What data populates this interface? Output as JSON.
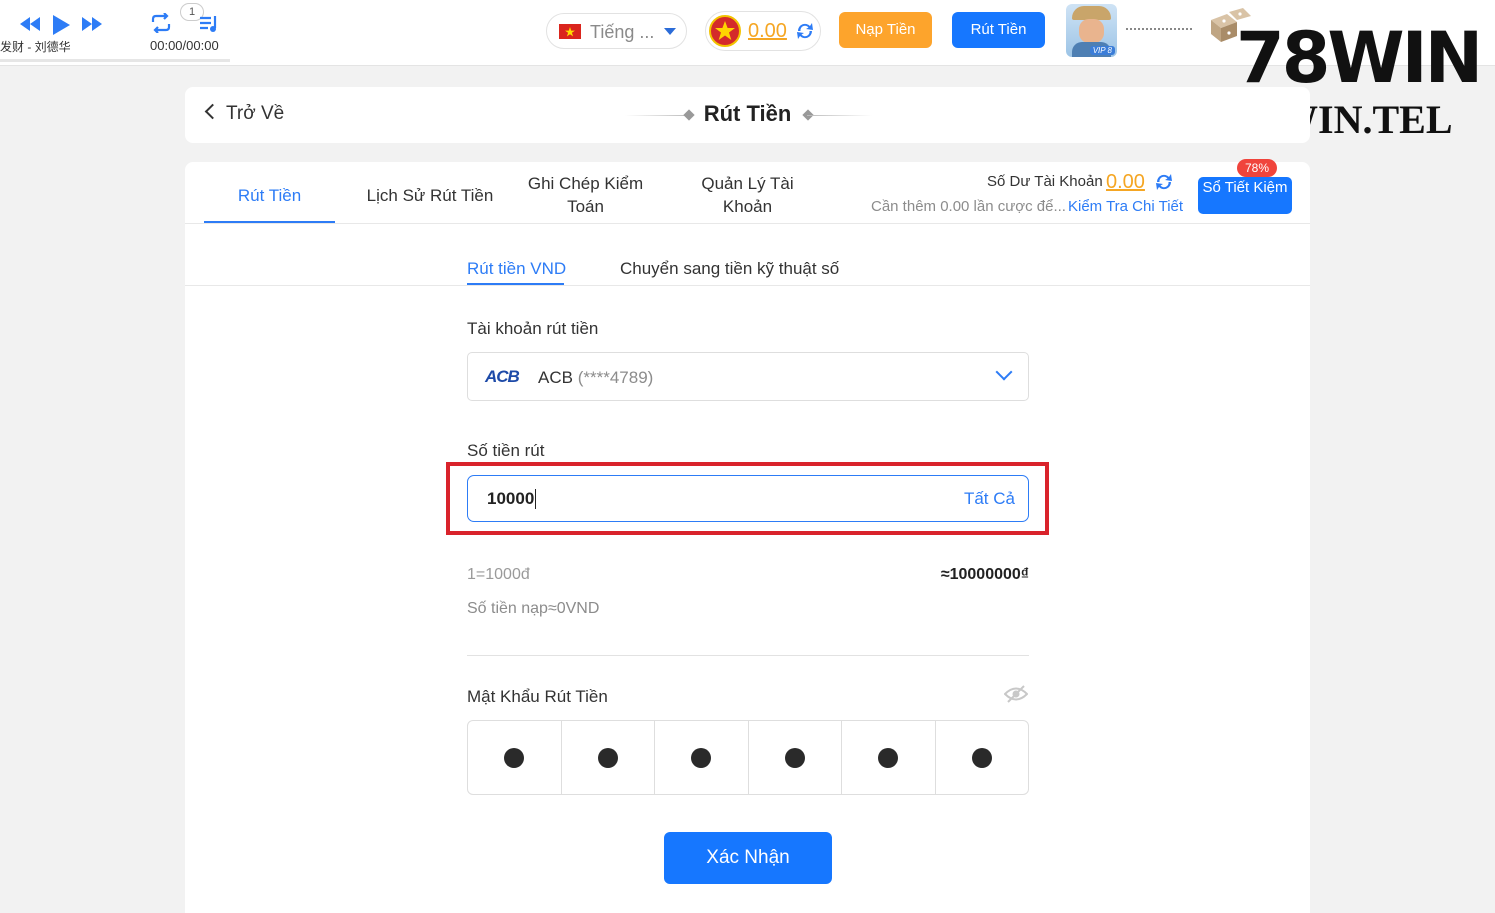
{
  "player": {
    "song": "发财 - 刘德华",
    "time": "00:00/00:00",
    "queue_count": "1"
  },
  "topbar": {
    "language": "Tiếng ...",
    "coin_balance": "0.00",
    "deposit_button": "Nạp Tiền",
    "withdraw_button": "Rút Tiền",
    "vip_label": "VIP 8"
  },
  "watermark": {
    "logo": "78WIN",
    "site": "78WIN.TEL"
  },
  "header": {
    "back_label": "Trở Về",
    "title": "Rút Tiền"
  },
  "tabs": [
    {
      "label": "Rút Tiền"
    },
    {
      "label": "Lịch Sử Rút Tiền"
    },
    {
      "label": "Ghi Chép Kiểm Toán"
    },
    {
      "label": "Quản Lý Tài Khoản"
    }
  ],
  "account_balance": {
    "label": "Số Dư Tài Khoản",
    "amount": "0.00",
    "wager_note": "Cần thêm 0.00 lần cược để...",
    "check_link": "Kiểm Tra Chi Tiết",
    "savings_button": "Sổ Tiết Kiệm",
    "savings_badge": "78%"
  },
  "subtabs": [
    {
      "label": "Rút tiền VND"
    },
    {
      "label": "Chuyển sang tiền kỹ thuật số"
    }
  ],
  "form": {
    "account_label": "Tài khoản rút tiền",
    "bank_logo": "ACB",
    "bank_name": "ACB",
    "bank_account": "(****4789)",
    "amount_label": "Số tiền rút",
    "amount_value": "10000",
    "all_button": "Tất Cả",
    "rate": "1=1000đ",
    "approx_value": "≈10000000₫",
    "deposit_note": "Số tiền nạp≈0VND",
    "password_label": "Mật Khẩu Rút Tiền",
    "pin_length": 6,
    "confirm_button": "Xác Nhận"
  },
  "colors": {
    "primary": "#1677ff",
    "accent_orange": "#fda42c",
    "highlight_red": "#d9232b",
    "coin_text": "#f5a623"
  }
}
